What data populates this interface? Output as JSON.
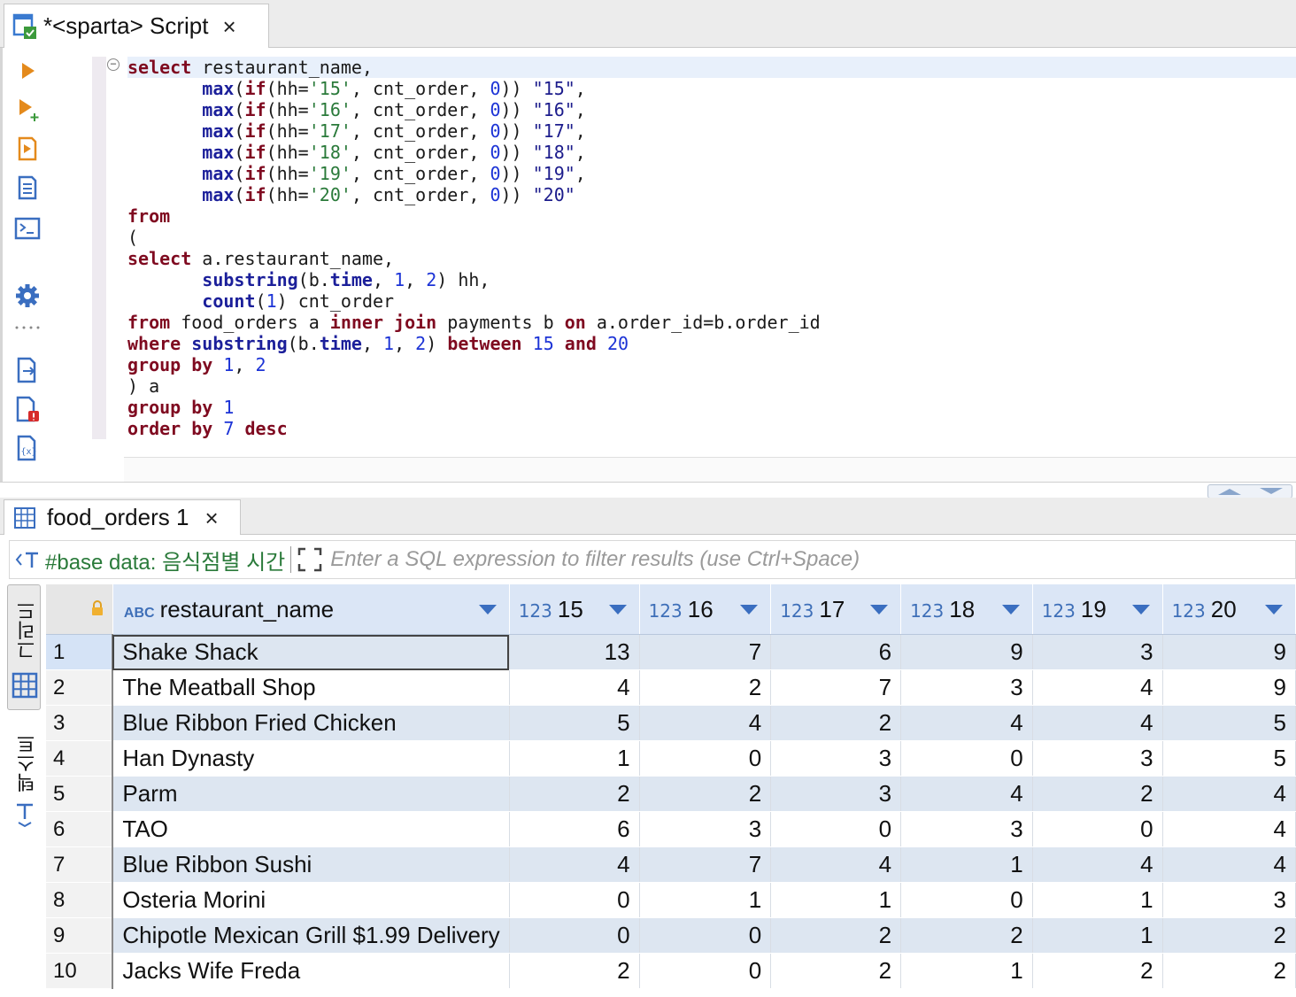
{
  "editor": {
    "tab_title": "*<sparta> Script",
    "close_glyph": "×",
    "icon": "sql-script-icon",
    "fold_glyph": "−"
  },
  "toolbar": {
    "icons": [
      "execute-statement-icon",
      "execute-in-new-tab-icon",
      "execute-script-icon",
      "execute-script-new-tab-icon",
      "explain-plan-icon",
      "settings-gear-icon",
      "more-dots-icon",
      "export-icon",
      "problems-icon",
      "variables-icon"
    ]
  },
  "sql_lines": [
    [
      [
        "kw",
        "select"
      ],
      [
        "t",
        " restaurant_name,"
      ]
    ],
    [
      [
        "t",
        "       "
      ],
      [
        "fn",
        "max"
      ],
      [
        "t",
        "("
      ],
      [
        "kw",
        "if"
      ],
      [
        "t",
        "(hh="
      ],
      [
        "str",
        "'15'"
      ],
      [
        "t",
        ", cnt_order, "
      ],
      [
        "num",
        "0"
      ],
      [
        "t",
        ")) "
      ],
      [
        "qid",
        "\"15\""
      ],
      [
        "t",
        ","
      ]
    ],
    [
      [
        "t",
        "       "
      ],
      [
        "fn",
        "max"
      ],
      [
        "t",
        "("
      ],
      [
        "kw",
        "if"
      ],
      [
        "t",
        "(hh="
      ],
      [
        "str",
        "'16'"
      ],
      [
        "t",
        ", cnt_order, "
      ],
      [
        "num",
        "0"
      ],
      [
        "t",
        ")) "
      ],
      [
        "qid",
        "\"16\""
      ],
      [
        "t",
        ","
      ]
    ],
    [
      [
        "t",
        "       "
      ],
      [
        "fn",
        "max"
      ],
      [
        "t",
        "("
      ],
      [
        "kw",
        "if"
      ],
      [
        "t",
        "(hh="
      ],
      [
        "str",
        "'17'"
      ],
      [
        "t",
        ", cnt_order, "
      ],
      [
        "num",
        "0"
      ],
      [
        "t",
        ")) "
      ],
      [
        "qid",
        "\"17\""
      ],
      [
        "t",
        ","
      ]
    ],
    [
      [
        "t",
        "       "
      ],
      [
        "fn",
        "max"
      ],
      [
        "t",
        "("
      ],
      [
        "kw",
        "if"
      ],
      [
        "t",
        "(hh="
      ],
      [
        "str",
        "'18'"
      ],
      [
        "t",
        ", cnt_order, "
      ],
      [
        "num",
        "0"
      ],
      [
        "t",
        ")) "
      ],
      [
        "qid",
        "\"18\""
      ],
      [
        "t",
        ","
      ]
    ],
    [
      [
        "t",
        "       "
      ],
      [
        "fn",
        "max"
      ],
      [
        "t",
        "("
      ],
      [
        "kw",
        "if"
      ],
      [
        "t",
        "(hh="
      ],
      [
        "str",
        "'19'"
      ],
      [
        "t",
        ", cnt_order, "
      ],
      [
        "num",
        "0"
      ],
      [
        "t",
        ")) "
      ],
      [
        "qid",
        "\"19\""
      ],
      [
        "t",
        ","
      ]
    ],
    [
      [
        "t",
        "       "
      ],
      [
        "fn",
        "max"
      ],
      [
        "t",
        "("
      ],
      [
        "kw",
        "if"
      ],
      [
        "t",
        "(hh="
      ],
      [
        "str",
        "'20'"
      ],
      [
        "t",
        ", cnt_order, "
      ],
      [
        "num",
        "0"
      ],
      [
        "t",
        ")) "
      ],
      [
        "qid",
        "\"20\""
      ]
    ],
    [
      [
        "kw",
        "from"
      ]
    ],
    [
      [
        "t",
        "("
      ]
    ],
    [
      [
        "kw",
        "select"
      ],
      [
        "t",
        " a.restaurant_name,"
      ]
    ],
    [
      [
        "t",
        "       "
      ],
      [
        "fn",
        "substring"
      ],
      [
        "t",
        "(b."
      ],
      [
        "fn",
        "time"
      ],
      [
        "t",
        ", "
      ],
      [
        "num",
        "1"
      ],
      [
        "t",
        ", "
      ],
      [
        "num",
        "2"
      ],
      [
        "t",
        ") hh,"
      ]
    ],
    [
      [
        "t",
        "       "
      ],
      [
        "fn",
        "count"
      ],
      [
        "t",
        "("
      ],
      [
        "num",
        "1"
      ],
      [
        "t",
        ") cnt_order"
      ]
    ],
    [
      [
        "kw",
        "from"
      ],
      [
        "t",
        " food_orders a "
      ],
      [
        "kw",
        "inner join"
      ],
      [
        "t",
        " payments b "
      ],
      [
        "kw",
        "on"
      ],
      [
        "t",
        " a.order_id=b.order_id"
      ]
    ],
    [
      [
        "kw",
        "where"
      ],
      [
        "t",
        " "
      ],
      [
        "fn",
        "substring"
      ],
      [
        "t",
        "(b."
      ],
      [
        "fn",
        "time"
      ],
      [
        "t",
        ", "
      ],
      [
        "num",
        "1"
      ],
      [
        "t",
        ", "
      ],
      [
        "num",
        "2"
      ],
      [
        "t",
        ") "
      ],
      [
        "kw",
        "between"
      ],
      [
        "t",
        " "
      ],
      [
        "num",
        "15"
      ],
      [
        "t",
        " "
      ],
      [
        "kw",
        "and"
      ],
      [
        "t",
        " "
      ],
      [
        "num",
        "20"
      ]
    ],
    [
      [
        "kw",
        "group by"
      ],
      [
        "t",
        " "
      ],
      [
        "num",
        "1"
      ],
      [
        "t",
        ", "
      ],
      [
        "num",
        "2"
      ]
    ],
    [
      [
        "t",
        ") a"
      ]
    ],
    [
      [
        "kw",
        "group by"
      ],
      [
        "t",
        " "
      ],
      [
        "num",
        "1"
      ]
    ],
    [
      [
        "kw",
        "order by"
      ],
      [
        "t",
        " "
      ],
      [
        "num",
        "7"
      ],
      [
        "t",
        " "
      ],
      [
        "kw",
        "desc"
      ]
    ]
  ],
  "results": {
    "tab_title": "food_orders 1",
    "close_glyph": "×",
    "filter_label": "#base data: 음식점별 시간",
    "filter_placeholder": "Enter a SQL expression to filter results (use Ctrl+Space)",
    "vertical_tabs": {
      "grid": "그리드",
      "text": "텍스트"
    },
    "columns": [
      {
        "type": "ABC",
        "name": "restaurant_name"
      },
      {
        "type": "123",
        "name": "15"
      },
      {
        "type": "123",
        "name": "16"
      },
      {
        "type": "123",
        "name": "17"
      },
      {
        "type": "123",
        "name": "18"
      },
      {
        "type": "123",
        "name": "19"
      },
      {
        "type": "123",
        "name": "20"
      }
    ],
    "rows": [
      [
        "1",
        "Shake Shack",
        "13",
        "7",
        "6",
        "9",
        "3",
        "9"
      ],
      [
        "2",
        "The Meatball Shop",
        "4",
        "2",
        "7",
        "3",
        "4",
        "9"
      ],
      [
        "3",
        "Blue Ribbon Fried Chicken",
        "5",
        "4",
        "2",
        "4",
        "4",
        "5"
      ],
      [
        "4",
        "Han Dynasty",
        "1",
        "0",
        "3",
        "0",
        "3",
        "5"
      ],
      [
        "5",
        "Parm",
        "2",
        "2",
        "3",
        "4",
        "2",
        "4"
      ],
      [
        "6",
        "TAO",
        "6",
        "3",
        "0",
        "3",
        "0",
        "4"
      ],
      [
        "7",
        "Blue Ribbon Sushi",
        "4",
        "7",
        "4",
        "1",
        "4",
        "4"
      ],
      [
        "8",
        "Osteria Morini",
        "0",
        "1",
        "1",
        "0",
        "1",
        "3"
      ],
      [
        "9",
        "Chipotle Mexican Grill $1.99 Delivery",
        "0",
        "0",
        "2",
        "2",
        "1",
        "2"
      ],
      [
        "10",
        "Jacks Wife Freda",
        "2",
        "0",
        "2",
        "1",
        "2",
        "2"
      ]
    ]
  },
  "colors": {
    "keyword": "#7f0a20",
    "function": "#1b1f9a",
    "number": "#1c33d6",
    "string": "#2a7a3a",
    "header_bg": "#dbe6f6",
    "row_alt_bg": "#dde6f1"
  }
}
